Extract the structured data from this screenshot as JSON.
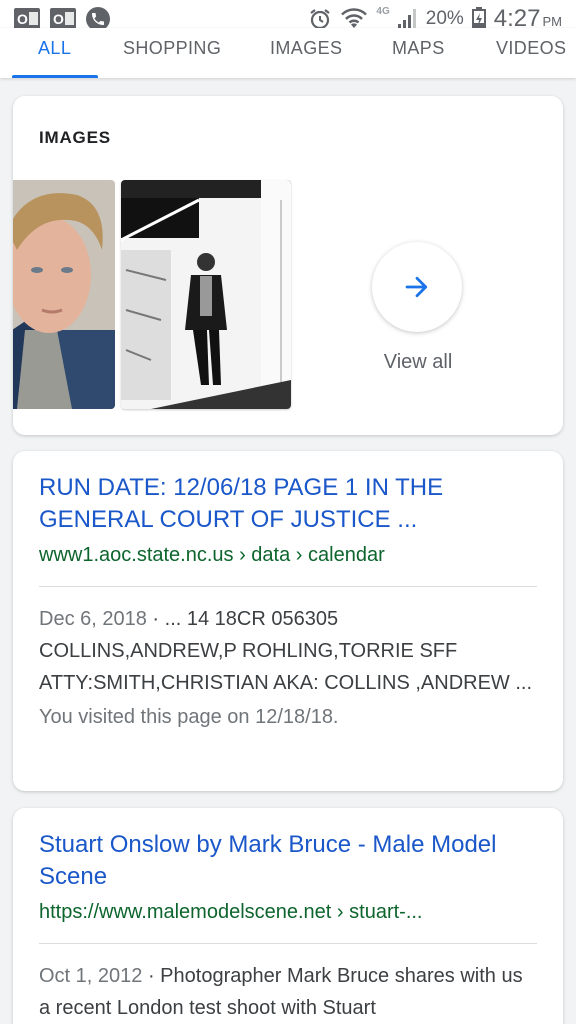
{
  "status_bar": {
    "battery": "20%",
    "time": "4:27",
    "ampm": "PM",
    "network": "4G"
  },
  "tabs": [
    {
      "label": "ALL",
      "active": true
    },
    {
      "label": "SHOPPING",
      "active": false
    },
    {
      "label": "IMAGES",
      "active": false
    },
    {
      "label": "MAPS",
      "active": false
    },
    {
      "label": "VIDEOS",
      "active": false
    }
  ],
  "images_section": {
    "title": "IMAGES",
    "view_all_label": "View all"
  },
  "results": [
    {
      "title": "RUN DATE: 12/06/18 PAGE 1 IN THE GENERAL COURT OF JUSTICE ...",
      "url": "www1.aoc.state.nc.us › data › calendar",
      "date": "Dec 6, 2018",
      "snippet": " · ... 14 18CR 056305 COLLINS,ANDREW,P ROHLING,TORRIE SFF ATTY:SMITH,CHRISTIAN AKA: COLLINS ,ANDREW ...",
      "visited": "You visited this page on 12/18/18."
    },
    {
      "title": "Stuart Onslow by Mark Bruce - Male Model Scene",
      "url": "https://www.malemodelscene.net › stuart-...",
      "date": "Oct 1, 2012",
      "snippet": " · Photographer Mark Bruce shares with us a recent London test shoot with Stuart"
    }
  ]
}
